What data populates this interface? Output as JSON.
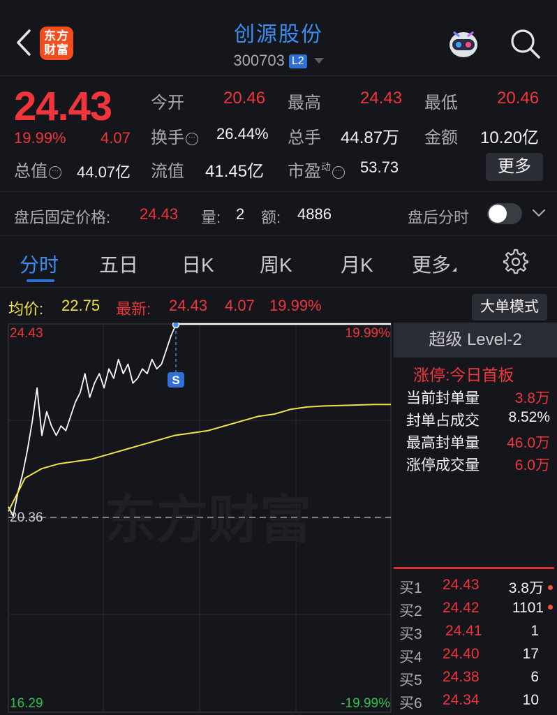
{
  "header": {
    "logo_text_line1": "东方",
    "logo_text_line2": "财富",
    "stock_name": "创源股份",
    "stock_code": "300703",
    "level_badge": "L2",
    "icons": [
      "back-icon",
      "robot-assistant-icon",
      "search-icon"
    ]
  },
  "quote": {
    "price": "24.43",
    "change_pct": "19.99%",
    "change": "4.07",
    "open_label": "今开",
    "open_value": "20.46",
    "high_label": "最高",
    "high_value": "24.43",
    "low_label": "最低",
    "low_value": "20.46",
    "turnover_label": "换手",
    "turnover_value": "26.44%",
    "volume_label": "总手",
    "volume_value": "44.87万",
    "amount_label": "金额",
    "amount_value": "10.20亿",
    "mktcap_label": "总值",
    "mktcap_value": "44.07亿",
    "float_label": "流值",
    "float_value": "41.45亿",
    "pe_label": "市盈",
    "pe_sup": "动",
    "pe_value": "53.73",
    "more_button": "更多"
  },
  "after_hours": {
    "price_label": "盘后固定价格:",
    "price_value": "24.43",
    "qty_label": "量:",
    "qty_value": "2",
    "amt_label": "额:",
    "amt_value": "4886",
    "timeshare_label": "盘后分时",
    "toggle_on": false
  },
  "tabs": [
    "分时",
    "五日",
    "日K",
    "周K",
    "月K",
    "更多"
  ],
  "active_tab": "分时",
  "infobar": {
    "avg_label": "均价:",
    "avg_value": "22.75",
    "latest_label": "最新:",
    "latest_value": "24.43",
    "latest_change": "4.07",
    "latest_pct": "19.99%",
    "big_order_button": "大单模式"
  },
  "chart_data": {
    "type": "line",
    "y_top_label": "24.43",
    "y_mid_label": "20.36",
    "y_bottom_label": "16.29",
    "pct_top_label": "19.99%",
    "pct_bottom_label": "-19.99%",
    "ylim": [
      16.29,
      24.43
    ],
    "watermark": "东方财富",
    "marker_label": "S",
    "series": [
      {
        "values": [
          20.6,
          20.4,
          20.9,
          21.3,
          21.8,
          22.4,
          23.1,
          22.1,
          22.6,
          22.3,
          22.1,
          22.3,
          22.2,
          22.5,
          22.8,
          23.0,
          23.4,
          22.9,
          23.2,
          23.4,
          23.1,
          23.5,
          23.3,
          23.7,
          23.4,
          23.6,
          23.2,
          23.3,
          23.5,
          23.4,
          23.7,
          23.5,
          23.6,
          23.9,
          24.2,
          24.43
        ]
      },
      {
        "values": [
          20.5,
          21.2,
          21.4,
          21.5,
          21.55,
          21.6,
          21.7,
          21.8,
          21.9,
          22.0,
          22.1,
          22.15,
          22.2,
          22.3,
          22.4,
          22.5,
          22.55,
          22.65,
          22.7,
          22.72,
          22.73,
          22.74,
          22.75,
          22.75
        ]
      }
    ]
  },
  "panel": {
    "title": "超级 Level-2",
    "limit_status": "涨停:今日首板",
    "rows": [
      {
        "label": "当前封单量",
        "value": "3.8万"
      },
      {
        "label": "封单占成交",
        "value": "8.52%"
      },
      {
        "label": "最高封单量",
        "value": "46.0万"
      },
      {
        "label": "涨停成交量",
        "value": "6.0万"
      }
    ],
    "bids": [
      {
        "label": "买1",
        "price": "24.43",
        "qty": "3.8万"
      },
      {
        "label": "买2",
        "price": "24.42",
        "qty": "1101"
      },
      {
        "label": "买3",
        "price": "24.41",
        "qty": "1"
      },
      {
        "label": "买4",
        "price": "24.40",
        "qty": "17"
      },
      {
        "label": "买5",
        "price": "24.38",
        "qty": "6"
      },
      {
        "label": "买6",
        "price": "24.34",
        "qty": "10"
      }
    ]
  },
  "colors": {
    "up": "#f0363c",
    "down": "#2fc04a",
    "accent": "#2f6fd6",
    "avg_line": "#f2e24a",
    "background": "#15161b"
  }
}
